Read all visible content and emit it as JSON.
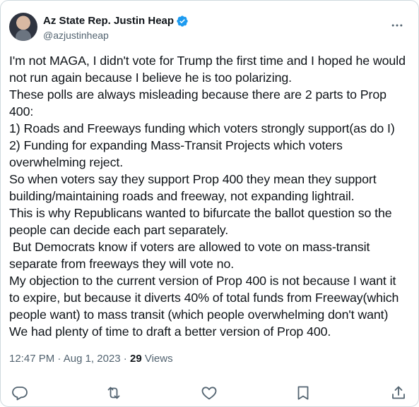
{
  "author": {
    "display_name": "Az State Rep. Justin Heap",
    "handle": "@azjustinheap",
    "verified": true
  },
  "tweet": {
    "text": "I'm not MAGA, I didn't vote for Trump the first time and I hoped he would\nnot run again because I believe he is too polarizing.\nThese polls are always misleading because there are 2 parts to Prop\n400:\n1) Roads and Freeways funding which voters strongly support(as do I)\n2) Funding for expanding Mass-Transit Projects which voters\noverwhelming reject.\nSo when voters say they support Prop 400 they mean they support\nbuilding/maintaining roads and freeway, not expanding lightrail.\nThis is why Republicans wanted to bifurcate the ballot question so the\npeople can decide each part separately.\n But Democrats know if voters are allowed to vote on mass-transit\nseparate from freeways they will vote no.\nMy objection to the current version of Prop 400 is not because I want it\nto expire, but because it diverts 40% of total funds from Freeway(which\npeople want) to mass transit (which people overwhelming don't want)\nWe had plenty of time to draft a better version of Prop 400."
  },
  "meta": {
    "time": "12:47 PM",
    "separator": " · ",
    "date": "Aug 1, 2023",
    "views_count": "29",
    "views_label": " Views"
  },
  "icons": {
    "verified": "verified-badge-icon",
    "more": "more-horizontal-icon",
    "reply": "reply-icon",
    "retweet": "retweet-icon",
    "like": "like-icon",
    "bookmark": "bookmark-icon",
    "share": "share-icon"
  },
  "colors": {
    "text": "#0f1419",
    "secondary": "#536471",
    "verified": "#1d9bf0",
    "border": "#cfd9de"
  }
}
